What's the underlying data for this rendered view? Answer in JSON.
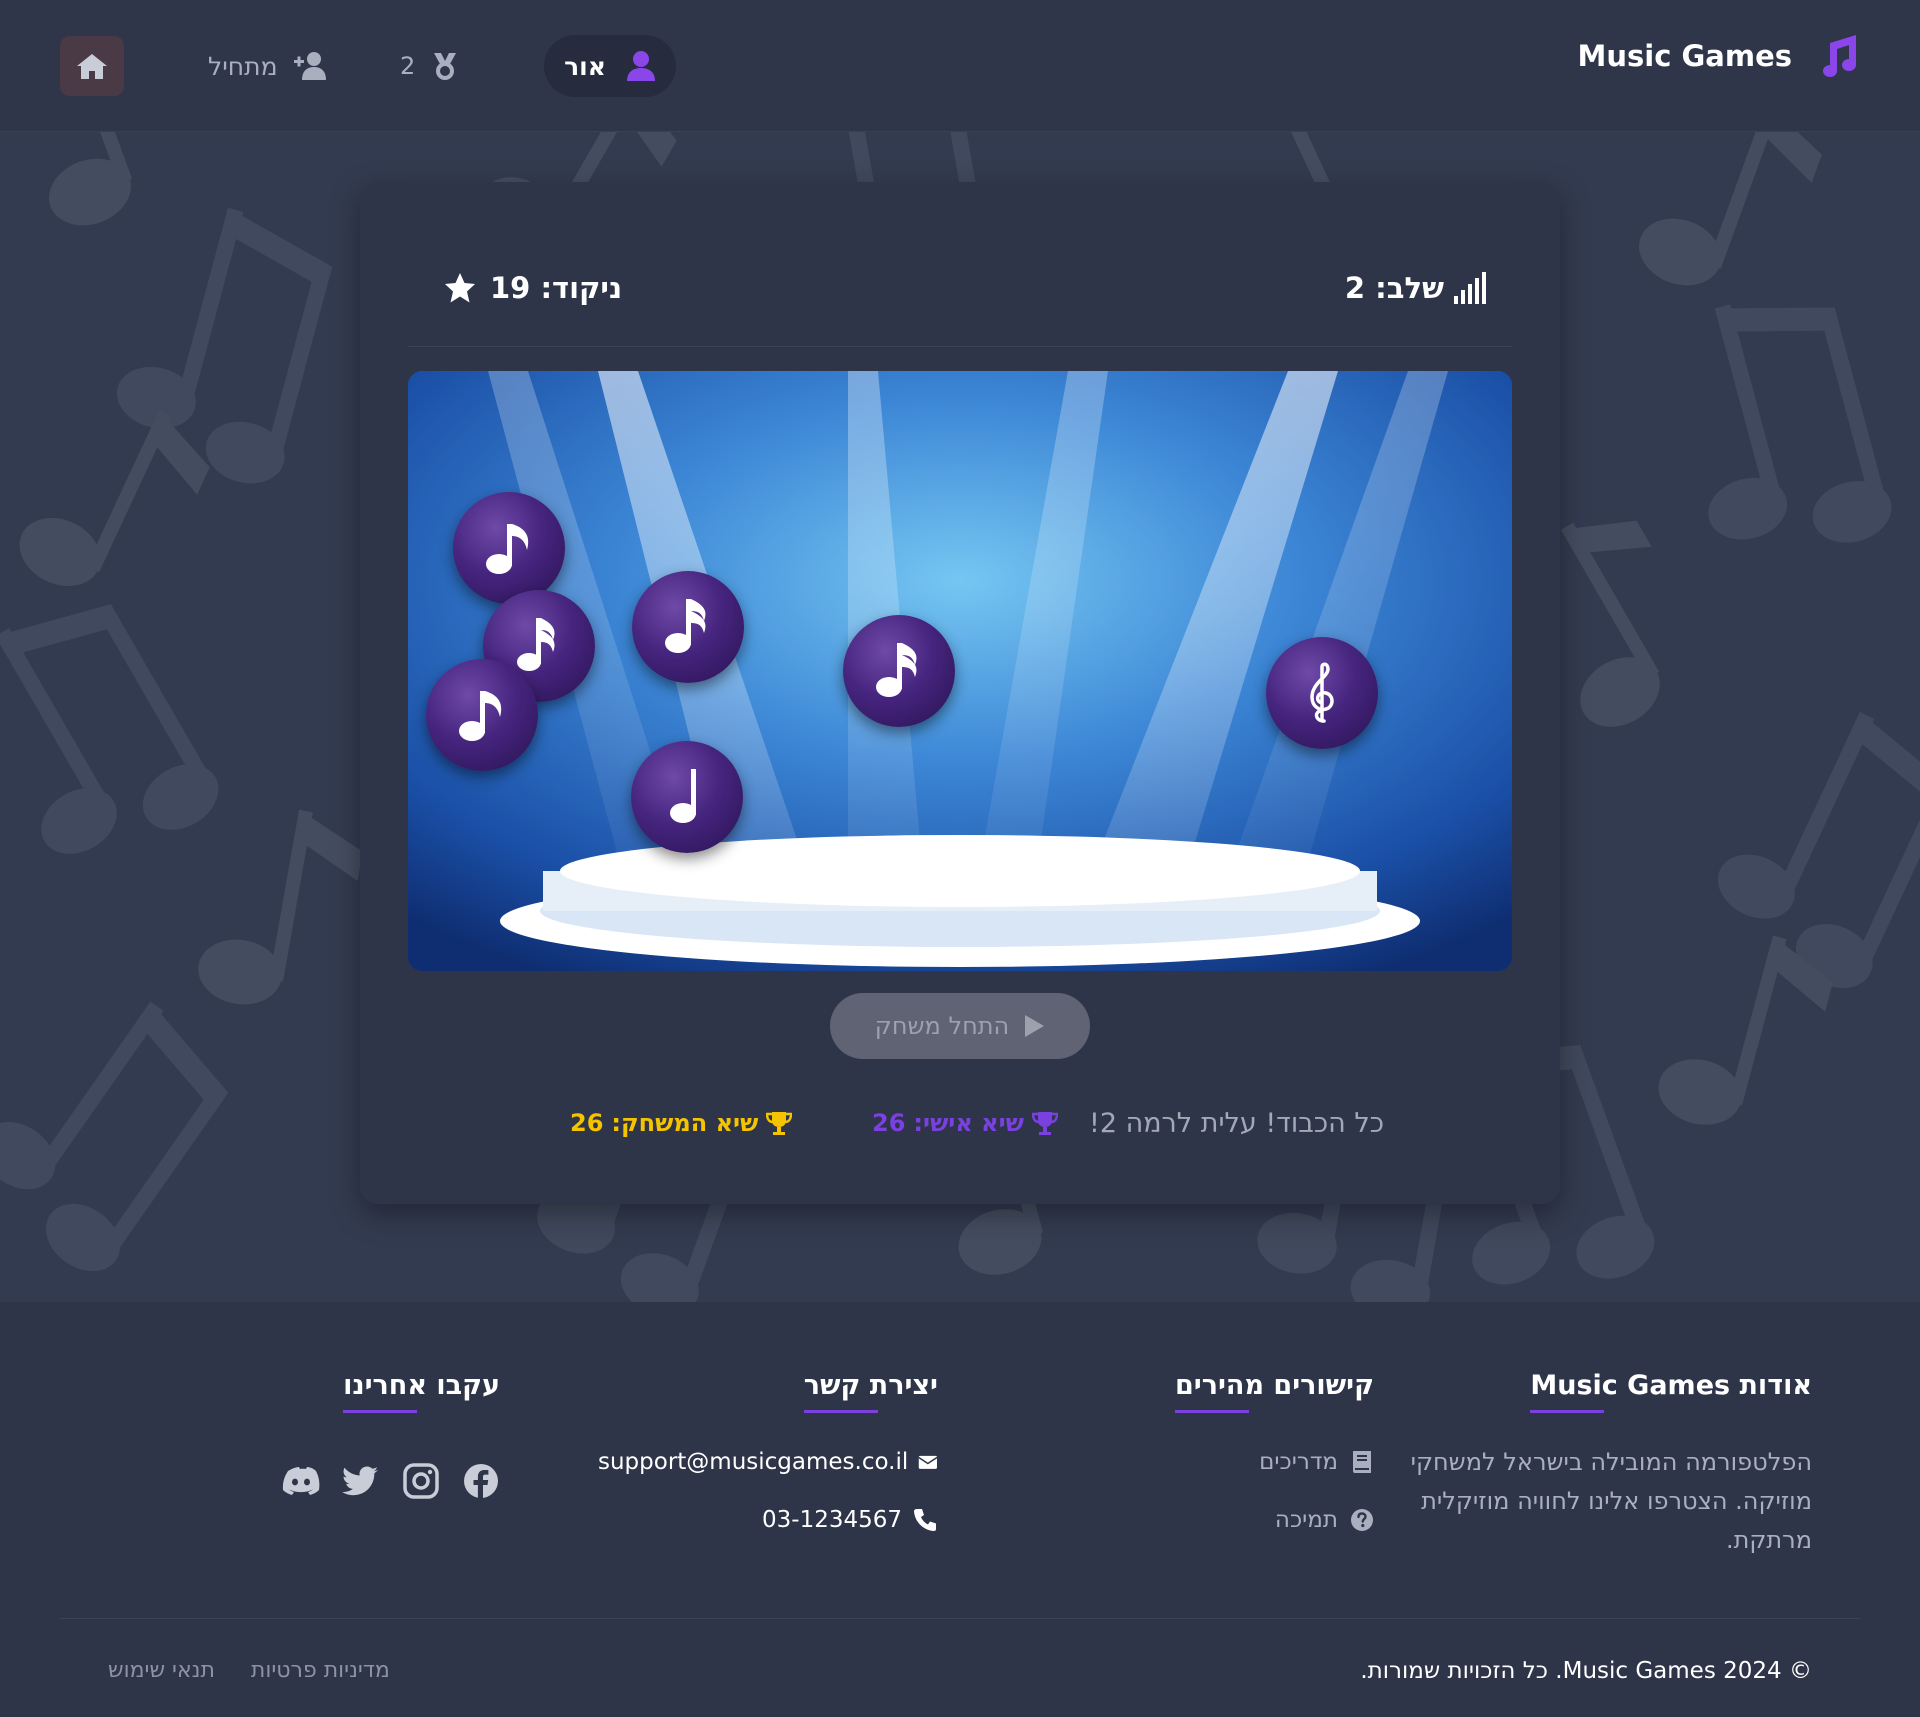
{
  "header": {
    "brand_title": "Music Games",
    "user_name": "אור",
    "medal_count": "2",
    "beginner_label": "מתחיל"
  },
  "game": {
    "level_label": "שלב: 2",
    "score_label": "ניקוד: 19",
    "start_button": "התחל משחק",
    "congrats": "כל הכבוד! עלית לרמה 2!",
    "personal_best_label": "שיא אישי:",
    "personal_best_value": "26",
    "game_best_label": "שיא המשחק:",
    "game_best_value": "26"
  },
  "footer": {
    "about_title": "אודות Music Games",
    "about_text": "הפלטפורמה המובילה בישראל למשחקי מוזיקה. הצטרפו אלינו לחוויה מוזיקלית מרתקת.",
    "links_title": "קישורים מהירים",
    "links": [
      "מדריכים",
      "תמיכה"
    ],
    "contact_title": "יצירת קשר",
    "email": "support@musicgames.co.il",
    "phone": "03-1234567",
    "social_title": "עקבו אחרינו",
    "copyright": "© 2024 Music Games. כל הזכויות שמורות.",
    "legal": [
      "תנאי שימוש",
      "מדיניות פרטיות"
    ]
  },
  "icons": [
    "music-note-icon",
    "user-icon",
    "medal-icon",
    "add-user-icon",
    "home-icon",
    "signal-icon",
    "star-icon",
    "play-icon",
    "trophy-icon",
    "book-icon",
    "question-circle-icon",
    "envelope-icon",
    "phone-icon",
    "facebook-icon",
    "instagram-icon",
    "twitter-icon",
    "discord-icon"
  ],
  "colors": {
    "accent": "#7a40e0",
    "gold": "#f5c400",
    "background": "#2e3548"
  }
}
